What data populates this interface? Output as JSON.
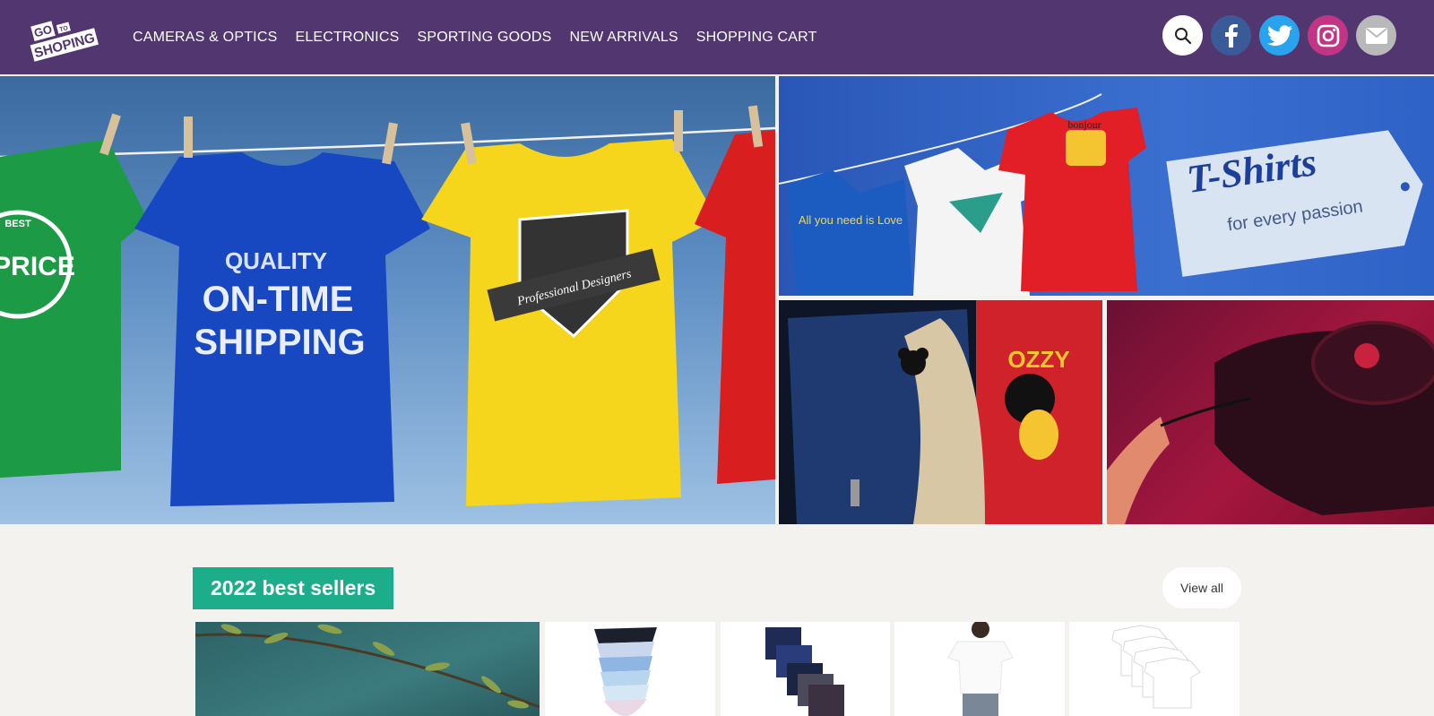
{
  "brand": {
    "logo_line1": "GO",
    "logo_line2": "TO",
    "logo_line3": "SHOPING"
  },
  "nav": {
    "items": [
      {
        "label": "CAMERAS & OPTICS"
      },
      {
        "label": "ELECTRONICS"
      },
      {
        "label": "SPORTING GOODS"
      },
      {
        "label": "NEW ARRIVALS"
      },
      {
        "label": "SHOPPING CART"
      }
    ]
  },
  "socials": [
    {
      "icon": "search-icon"
    },
    {
      "icon": "facebook-icon"
    },
    {
      "icon": "twitter-icon"
    },
    {
      "icon": "instagram-icon"
    },
    {
      "icon": "mail-icon"
    }
  ],
  "hero": {
    "shirt_green_text": "PRICE",
    "shirt_green_arc_top": "BEST",
    "shirt_blue_line1": "QUALITY",
    "shirt_blue_line2": "ON-TIME",
    "shirt_blue_line3": "SHIPPING",
    "shirt_yellow_ribbon": "Professional Designers"
  },
  "tshirts_tile": {
    "title": "T-Shirts",
    "subtitle": "for every passion",
    "shirt_text_love": "All you need is Love",
    "shirt_text_bonjour": "bonjour"
  },
  "jacket_tile": {
    "patch_text": "OZZY"
  },
  "best_sellers": {
    "title": "2022 best sellers",
    "view_all": "View all"
  },
  "colors": {
    "header_bg": "#523670",
    "accent_green": "#1cae8b",
    "page_bg": "#f3f2ee"
  }
}
